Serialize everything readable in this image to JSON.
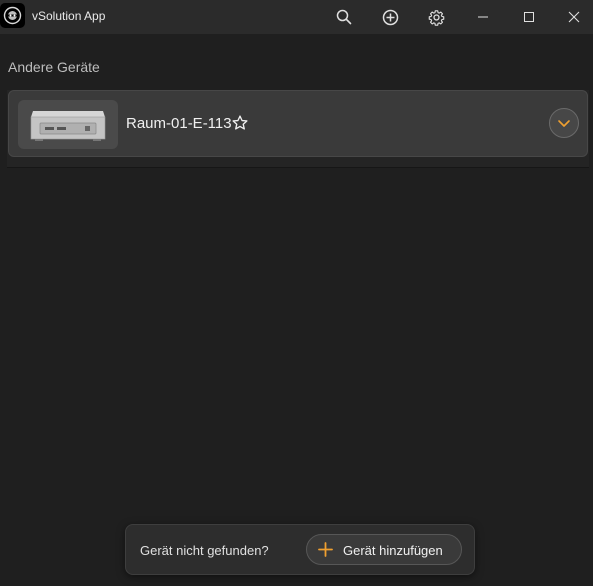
{
  "window": {
    "title": "vSolution App",
    "icons": {
      "app": "app-logo-icon",
      "search": "search-icon",
      "add": "add-circle-icon",
      "settings": "gear-icon",
      "minimize": "minimize-icon",
      "maximize": "maximize-icon",
      "close": "close-icon"
    }
  },
  "section": {
    "title": "Andere Geräte"
  },
  "devices": [
    {
      "name": "Raum-01-E-113",
      "favorite": false,
      "icons": {
        "image": "device-box-icon",
        "favorite": "star-outline-icon",
        "expand": "chevron-down-icon"
      }
    }
  ],
  "footer": {
    "prompt": "Gerät nicht gefunden?",
    "add_button_label": "Gerät hinzufügen",
    "add_icon": "plus-icon"
  },
  "colors": {
    "background": "#1f1f1f",
    "titlebar": "#2b2b2b",
    "card": "#3a3a3a",
    "accent": "#f0a030"
  }
}
